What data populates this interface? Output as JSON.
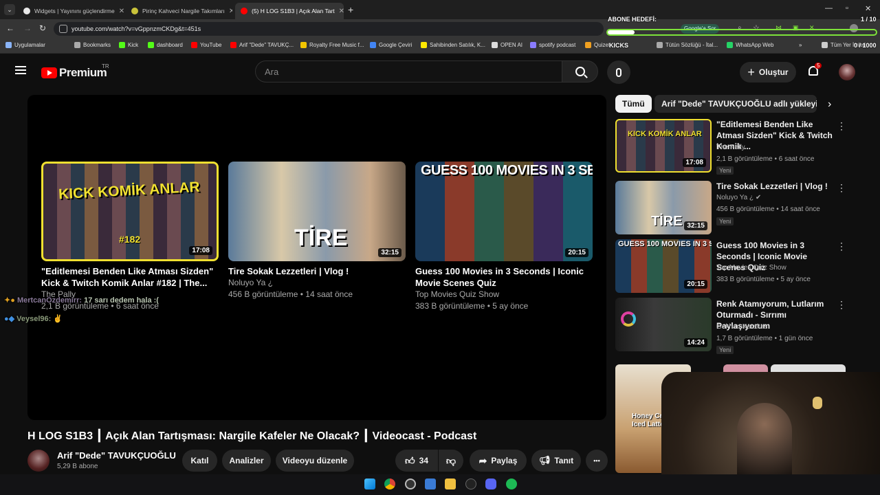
{
  "browser": {
    "tabs": [
      {
        "title": "Widgets | Yayınını güçlendirme",
        "color": "#e8e8e8"
      },
      {
        "title": "Pirinç Kahveci Nargile Takımları",
        "color": "#c9c23a"
      },
      {
        "title": "(5) H LOG S1B3 | Açık Alan Tart",
        "color": "#ff0000"
      }
    ],
    "new_tab": "+",
    "url": "youtube.com/watch?v=vGppnzmCKDg&t=451s",
    "bookmarks": [
      {
        "label": "Uygulamalar",
        "color": "#8ab4f8"
      },
      {
        "label": "Bookmarks",
        "color": "#aaaaaa"
      },
      {
        "label": "Kick",
        "color": "#53fc18"
      },
      {
        "label": "dashboard",
        "color": "#53fc18"
      },
      {
        "label": "YouTube",
        "color": "#ff0000"
      },
      {
        "label": "Arif \"Dede\" TAVUKÇ...",
        "color": "#ff0000"
      },
      {
        "label": "Royalty Free Music f...",
        "color": "#f2c500"
      },
      {
        "label": "Google Çeviri",
        "color": "#4285f4"
      },
      {
        "label": "Sahibinden Satılık, K...",
        "color": "#ffe800"
      },
      {
        "label": "OPEN AI",
        "color": "#dddddd"
      },
      {
        "label": "spotify podcast",
        "color": "#8a7cff"
      },
      {
        "label": "Quizet",
        "color": "#f0a020"
      },
      {
        "label": "Tütün Sözlüğü - İtal...",
        "color": "#aaaaaa"
      },
      {
        "label": "WhatsApp Web",
        "color": "#25d366"
      },
      {
        "label": "Tüm Yer İmleri",
        "color": "#cccccc"
      }
    ],
    "google_chip": "Google'a Sor"
  },
  "overlay": {
    "goal_label": "ABONE HEDEFİ:",
    "goal_count": "1 / 10",
    "goal_progress": 0.1,
    "kicks_label": "KICKS",
    "kicks_count": "0 / 1000",
    "kicks_progress": 0.0,
    "chat": [
      {
        "user": "MertcanÖzdemirr:",
        "message": "17 sarı dedem hala :("
      },
      {
        "user": "Veysel96:",
        "message": ""
      }
    ]
  },
  "youtube": {
    "logo": "Premium",
    "region": "TR",
    "search_placeholder": "Ara",
    "create_label": "Oluştur",
    "notif_count": "5",
    "endscreen": [
      {
        "title": "\"Editlemesi Benden Like Atması Sizden\" Kick & Twitch Komik Anlar #182 | The...",
        "channel": "The Pally",
        "meta": "2,1 B görüntüleme • 6 saat önce",
        "duration": "17:08",
        "thumb_text": "KICK KOMİK ANLAR",
        "thumb_sub": "#182"
      },
      {
        "title": "Tire Sokak Lezzetleri | Vlog !",
        "channel": "Noluyo Ya ¿",
        "meta": "456 B görüntüleme • 14 saat önce",
        "duration": "32:15",
        "thumb_text": "TİRE",
        "thumb_sub": ""
      },
      {
        "title": "Guess 100 Movies in 3 Seconds | Iconic Movie Scenes Quiz",
        "channel": "Top Movies Quiz Show",
        "meta": "383 B görüntüleme • 5 ay önce",
        "duration": "20:15",
        "thumb_text": "GUESS 100 MOVIES IN 3 SEC",
        "thumb_sub": ""
      }
    ],
    "video_title": "H LOG S1B3  ┃ Açık Alan Tartışması: Nargile Kafeler Ne Olacak? ┃ Videocast - Podcast",
    "channel_name": "Arif \"Dede\" TAVUKÇUOĞLU",
    "subscribers": "5,29 B abone",
    "buttons": {
      "join": "Katıl",
      "analytics": "Analizler",
      "edit": "Videoyu düzenle",
      "likes": "34",
      "share": "Paylaş",
      "promote": "Tanıt",
      "more": "•••"
    },
    "chips": [
      "Tümü",
      "Arif \"Dede\" TAVUKÇUOĞLU adlı yükleyiciden"
    ],
    "sidebar": [
      {
        "title": "\"Editlemesi Benden Like Atması Sizden\" Kick & Twitch Komik ...",
        "channel": "The Pally",
        "meta": "2,1 B görüntüleme • 6 saat önce",
        "duration": "17:08",
        "badge": "Yeni"
      },
      {
        "title": "Tire Sokak Lezzetleri | Vlog !",
        "channel": "Noluyo Ya ¿",
        "meta": "456 B görüntüleme • 14 saat önce",
        "duration": "32:15",
        "badge": "Yeni"
      },
      {
        "title": "Guess 100 Movies in 3 Seconds | Iconic Movie Scenes Quiz",
        "channel": "Top Movies Quiz Show",
        "meta": "383 B görüntüleme • 5 ay önce",
        "duration": "20:15",
        "badge": ""
      },
      {
        "title": "Renk Atamıyorum, Lutlarım Oturmadı - Sırrımı Paylaşıyorum",
        "channel": "Gokhan Karakas",
        "meta": "1,7 B görüntüleme • 1 gün önce",
        "duration": "14:24",
        "badge": "Yeni"
      }
    ],
    "ad_text": "Honey Cream Iced Latte"
  },
  "colors": {
    "accent": "#ff0000",
    "overlay_green": "#7ee33a",
    "highlight_yellow": "#f0e030"
  }
}
